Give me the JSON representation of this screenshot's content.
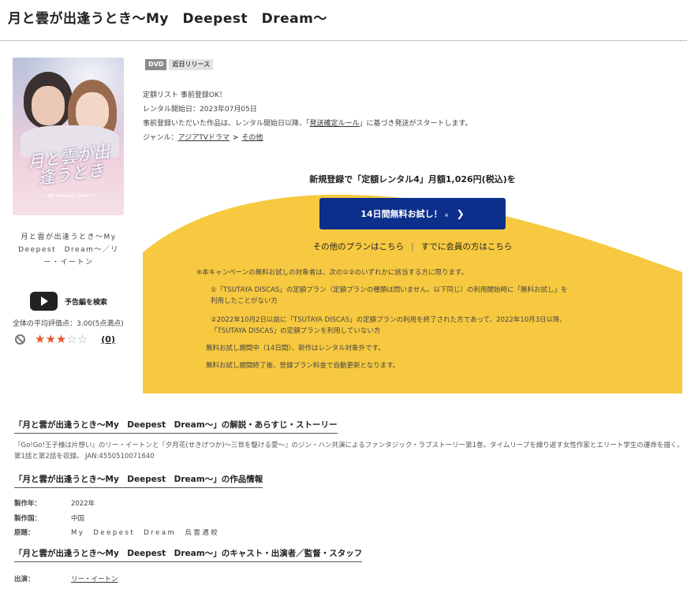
{
  "title": "月と雲が出逢うとき〜My　Deepest　Dream〜",
  "cover_caption": "月と雲が出逢うとき〜My　Deepest　Dream〜／リー・イートン",
  "cover_art": {
    "logo_text": "月と雲が出逢うとき",
    "logo_sub": "〜My Deepest Dream〜"
  },
  "trailer_label": "予告編を検索",
  "rating": {
    "label": "全体の平均評価点：",
    "value_text": "3.00(5点満点)",
    "stars": 3,
    "max_stars": 5,
    "review_count": "(0)"
  },
  "badges": [
    "DVD",
    "近日リリース"
  ],
  "info": {
    "line1": "定額リスト 事前登録OK！",
    "release": "レンタル開始日：2023年07月05日",
    "notice_pre": "事前登録いただいた作品は、レンタル開始日以降、「",
    "notice_link": "発送確定ルール",
    "notice_post": "」に基づき発送がスタートします。",
    "genre_label": "ジャンル：",
    "genre_main": "アジアTVドラマ",
    "genre_sep": ">",
    "genre_sub": "その他"
  },
  "campaign": {
    "heading": "新規登録で「定額レンタル4」月額1,026円(税込)を",
    "button_label": "14日間無料お試し！",
    "button_note": "※",
    "other_plans": "その他のプランはこちら",
    "separator": "|",
    "member_link": "すでに会員の方はこちら",
    "notes": [
      "※本キャンペーンの無料お試しの対象者は、次の①②のいずれかに該当する方に限ります。",
      "①「TSUTAYA DISCAS」の定額プラン（定額プランの種類は問いません。以下同じ）の利用開始時に「無料お試し」を",
      "利用したことがない方",
      "②2022年10月2日以前に「TSUTAYA DISCAS」の定額プランの利用を終了された方であって、2022年10月3日以降、",
      "「TSUTAYA DISCAS」の定額プランを利用していない方",
      "無料お試し期間中（14日間）、新作はレンタル対象外です。",
      "無料お試し期間終了後、登録プラン料金で自動更新となります。"
    ],
    "bg_color": "#f7c940",
    "button_color": "#0d2f8c"
  },
  "synopsis": {
    "heading": "「月と雲が出逢うとき〜My　Deepest　Dream〜」の解説・あらすじ・ストーリー",
    "text": "『Go!Go!王子様は片想い』のリー・イートンと『夕月花(せきげつか)〜三世を駆ける愛〜』のジン・ハン共演によるファンタジック・ラブストーリー第1巻。タイムリープを繰り返す女性作家とエリート学生の運命を描く。第1話と第2話を収録。 JAN:4550510071640"
  },
  "work_info": {
    "heading": "「月と雲が出逢うとき〜My　Deepest　Dream〜」の作品情報",
    "rows": [
      {
        "key": "製作年：",
        "value": "2022年"
      },
      {
        "key": "製作国：",
        "value": "中国"
      },
      {
        "key": "原題：",
        "value": "My　Deepest　Dream　烏雲遇皎"
      }
    ]
  },
  "cast": {
    "heading": "「月と雲が出逢うとき〜My　Deepest　Dream〜」のキャスト・出演者／監督・スタッフ",
    "key": "出演：",
    "value": "リー・イートン"
  }
}
